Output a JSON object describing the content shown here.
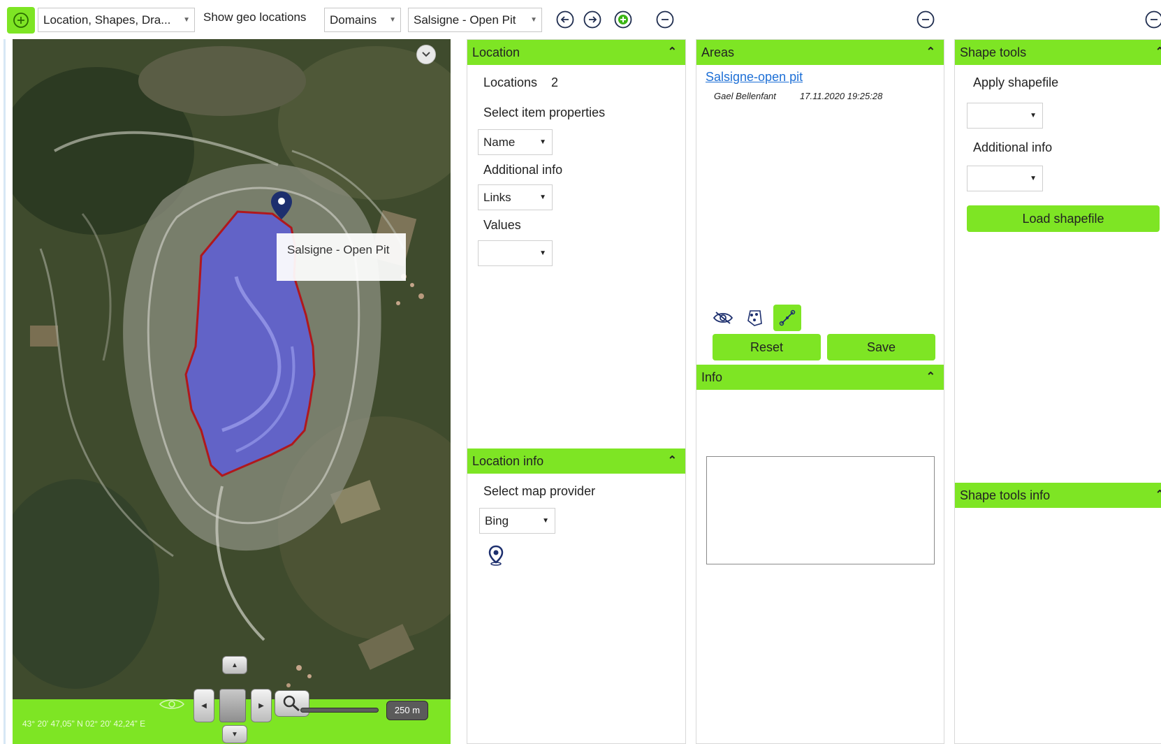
{
  "toolbar": {
    "view_select": "Location, Shapes, Dra...",
    "show_geo_label": "Show geo locations",
    "category_select": "Domains",
    "location_select": "Salsigne - Open Pit",
    "icons": [
      "add-circle-icon",
      "arrow-left-circle-icon",
      "arrow-right-circle-icon",
      "add-green-circle-icon",
      "minus-circle-icon"
    ]
  },
  "map": {
    "tooltip": "Salsigne - Open Pit",
    "coordinates": "43° 20' 47,05\" N 02° 20' 42,24\" E",
    "scale": "250 m",
    "area_fill": "#5b5be6",
    "area_stroke": "#b0181c"
  },
  "location_panel": {
    "title": "Location",
    "locations_label": "Locations",
    "locations_count": "2",
    "select_item_properties": "Select item properties",
    "name_select": "Name",
    "additional_info": "Additional info",
    "links_select": "Links",
    "values_label": "Values",
    "values_select": ""
  },
  "location_info_panel": {
    "title": "Location info",
    "select_map_provider": "Select map provider",
    "provider_select": "Bing"
  },
  "areas_panel": {
    "title": "Areas",
    "area_link": "Salsigne-open pit",
    "author": "Gael Bellenfant",
    "timestamp": "17.11.2020 19:25:28",
    "reset": "Reset",
    "save": "Save"
  },
  "info_panel": {
    "title": "Info"
  },
  "shape_tools_panel": {
    "title": "Shape tools",
    "apply_shapefile": "Apply shapefile",
    "additional_info": "Additional info",
    "load_shapefile": "Load shapefile"
  },
  "shape_tools_info_panel": {
    "title": "Shape tools info"
  },
  "colors": {
    "accent_green": "#7ee524",
    "link_blue": "#1d6fd6"
  }
}
